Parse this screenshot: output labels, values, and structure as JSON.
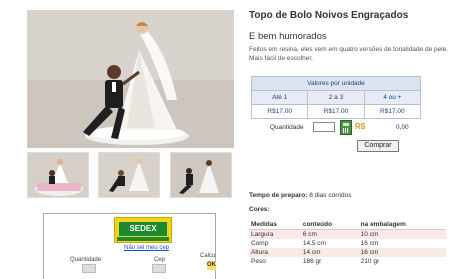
{
  "product": {
    "title": "Topo de Bolo Noivos Engraçados",
    "subtitle": "E bem humorados",
    "description": "Feitos em resina, eles vem em quatro versões de tonalidade de pele. Mais fácil de escolher."
  },
  "pricing": {
    "header": "Valores por unidade",
    "tiers": [
      "Até 1",
      "2 a 3",
      "4 ou +"
    ],
    "prices": [
      "R$17.00",
      "R$17.00",
      "R$17.00"
    ]
  },
  "purchase": {
    "quantity_label": "Quantidade",
    "quantity_value": "",
    "currency_label": "R$",
    "total": "0,00",
    "buy_label": "Comprar"
  },
  "prep": {
    "label": "Tempo de preparo:",
    "value": "8 dias corridos"
  },
  "colors_label": "Cores:",
  "measures": {
    "headers": [
      "Medidas",
      "conteúdo",
      "na embalagem"
    ],
    "rows": [
      [
        "Largura",
        "6 cm",
        "10 cm"
      ],
      [
        "Comp",
        "14,5 cm",
        "16 cm"
      ],
      [
        "Altura",
        "14 cm",
        "16 cm"
      ],
      [
        "Peso",
        "186 gr",
        "210 gr"
      ]
    ]
  },
  "shipping": {
    "logo_text": "SEDEX",
    "link_text": "Não sei meu cep",
    "quantity_label": "Quantidade",
    "cep_label": "Cep",
    "calc_label": "Calcu",
    "calc_button": "OK"
  },
  "colors": {
    "accent_blue": "#1d3e8a",
    "sedex_yellow": "#f3d21c",
    "sedex_green": "#1b8a2e",
    "row_pink": "#fae9e9"
  }
}
